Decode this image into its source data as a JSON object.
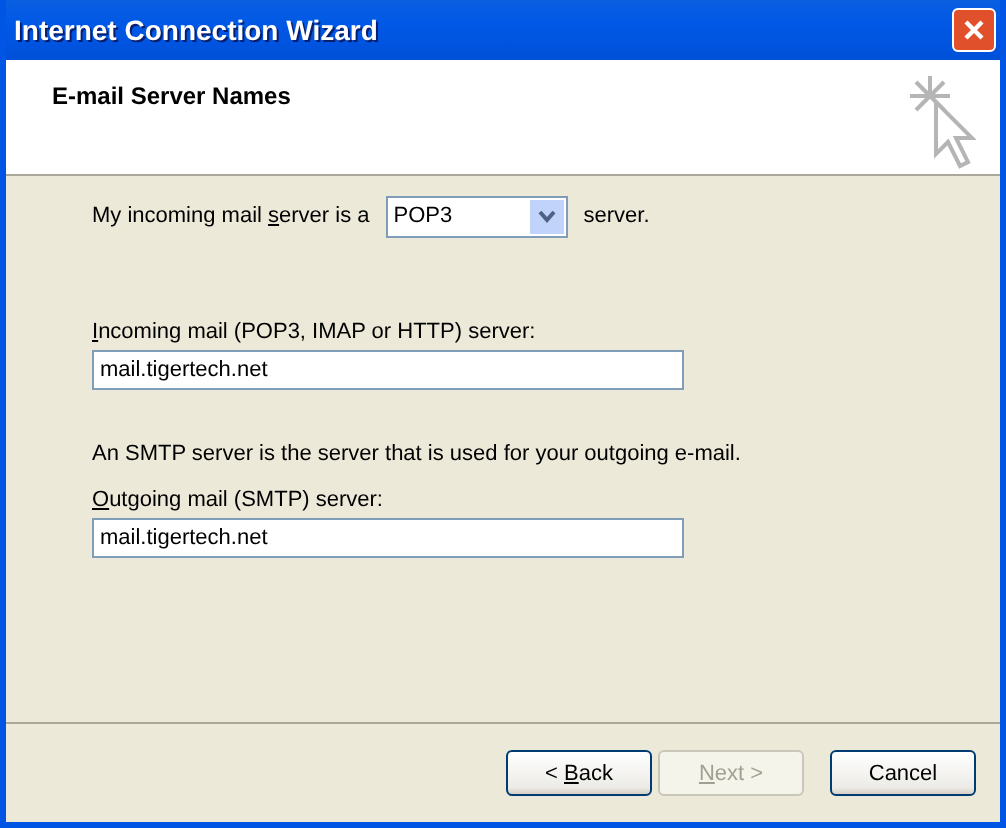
{
  "window": {
    "title": "Internet Connection Wizard"
  },
  "header": {
    "title": "E-mail Server Names"
  },
  "server_type": {
    "label": {
      "before": "My incoming mail ",
      "key": "s",
      "after": "erver is a"
    },
    "value": "POP3",
    "suffix": "server."
  },
  "incoming": {
    "label": {
      "key": "I",
      "after": "ncoming mail (POP3, IMAP or HTTP) server:"
    },
    "value": "mail.tigertech.net"
  },
  "smtp_note": "An SMTP server is the server that is used for your outgoing e-mail.",
  "outgoing": {
    "label": {
      "key": "O",
      "after": "utgoing mail (SMTP) server:"
    },
    "value": "mail.tigertech.net"
  },
  "buttons": [
    {
      "kind": "back",
      "label": {
        "before": "< ",
        "key": "B",
        "after": "ack"
      },
      "disabled": false
    },
    {
      "kind": "next",
      "label": {
        "key": "N",
        "after": "ext >"
      },
      "disabled": true
    },
    {
      "kind": "cancel",
      "label": {
        "before": "Cancel"
      },
      "disabled": false
    }
  ]
}
